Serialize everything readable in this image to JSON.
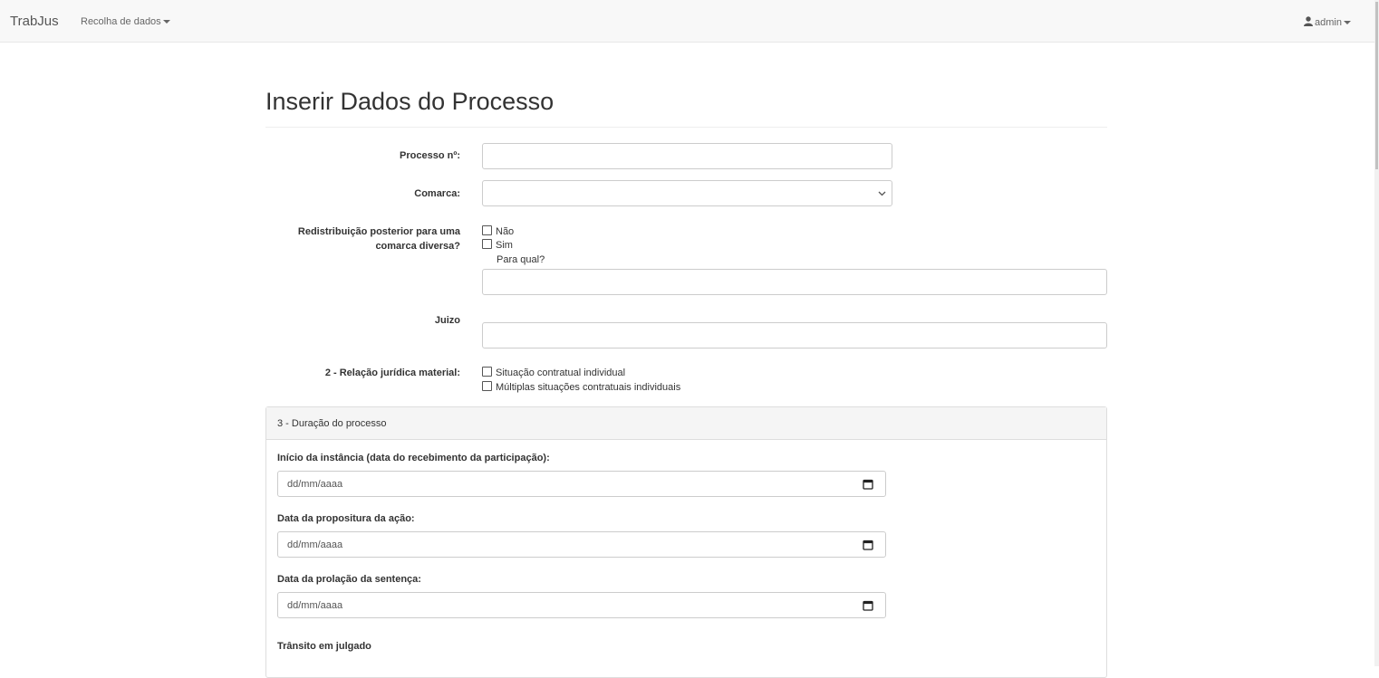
{
  "navbar": {
    "brand": "TrabJus",
    "menu_label": "Recolha de dados",
    "user_label": "admin",
    "icons": {
      "user": "user-icon",
      "caret": "caret-down-icon"
    }
  },
  "page": {
    "title": "Inserir Dados do Processo"
  },
  "form": {
    "processo": {
      "label": "Processo nº:",
      "value": ""
    },
    "comarca": {
      "label": "Comarca:",
      "selected": ""
    },
    "redistribuicao": {
      "label_line1": "Redistribuição posterior para uma",
      "label_line2": "comarca diversa?",
      "options": [
        {
          "label": "Não",
          "checked": false
        },
        {
          "label": "Sim",
          "checked": false
        }
      ],
      "para_qual_label": "Para qual?",
      "para_qual_value": ""
    },
    "juizo": {
      "label": "Juizo",
      "value": ""
    },
    "relacao": {
      "label": "2 - Relação jurídica material:",
      "options": [
        {
          "label": "Situação contratual individual",
          "checked": false
        },
        {
          "label": "Múltiplas situações contratuais individuais",
          "checked": false
        }
      ]
    }
  },
  "duracao_panel": {
    "title": "3 - Duração do processo",
    "fields": [
      {
        "label": "Início da instância (data do recebimento da participação):",
        "placeholder": "dd/mm/aaaa"
      },
      {
        "label": "Data da propositura da ação:",
        "placeholder": "dd/mm/aaaa"
      },
      {
        "label": "Data da prolação da sentença:",
        "placeholder": "dd/mm/aaaa"
      }
    ],
    "transito_label": "Trânsito em julgado"
  },
  "colors": {
    "navbar_bg": "#f8f8f8",
    "panel_heading_bg": "#f5f5f5",
    "border": "#cccccc",
    "text": "#333333"
  }
}
